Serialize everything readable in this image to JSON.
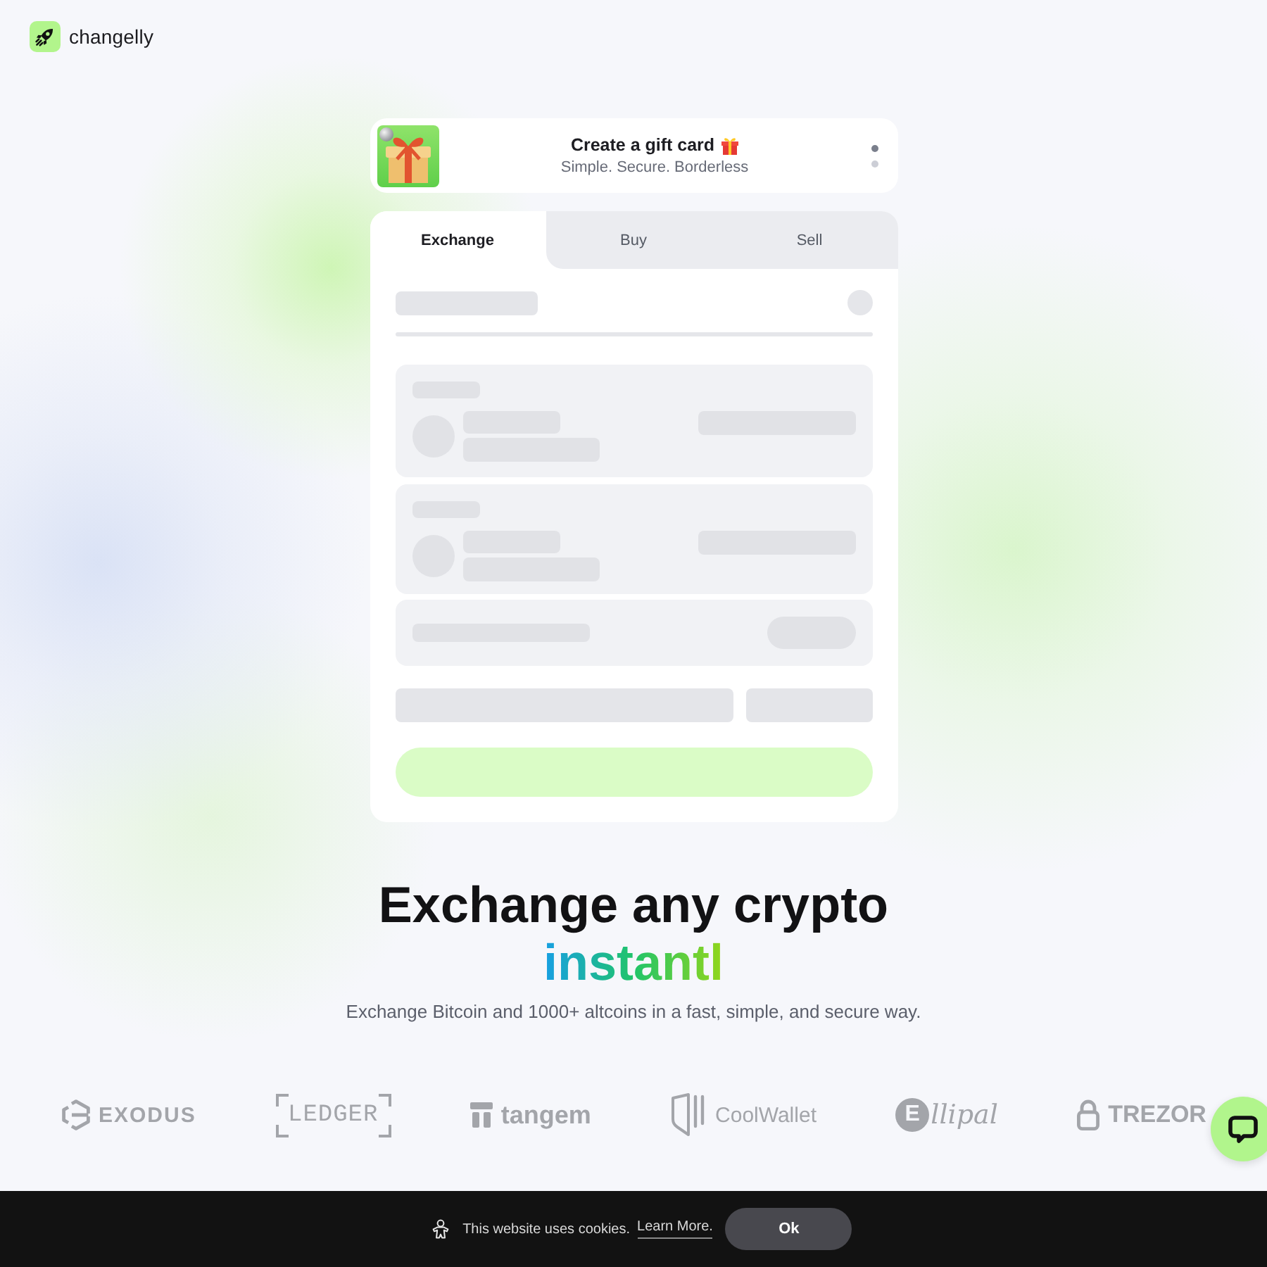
{
  "header": {
    "brand": "changelly"
  },
  "gift_banner": {
    "title": "Create a gift card",
    "subtitle": "Simple. Secure. Borderless",
    "dots": [
      {
        "selected": true
      },
      {
        "selected": false
      }
    ]
  },
  "tabs": [
    {
      "label": "Exchange",
      "selected": true
    },
    {
      "label": "Buy",
      "selected": false
    },
    {
      "label": "Sell",
      "selected": false
    }
  ],
  "hero": {
    "title": "Exchange any crypto",
    "highlight": "instantl",
    "subtitle": "Exchange Bitcoin and 1000+ altcoins in a fast, simple, and secure way."
  },
  "partners": [
    {
      "kind": "exodus",
      "name": "EXODUS"
    },
    {
      "kind": "ledger",
      "name": "LEDGER"
    },
    {
      "kind": "tangem",
      "name": "tangem"
    },
    {
      "kind": "coolwallet",
      "name": "CoolWallet"
    },
    {
      "kind": "ellipal",
      "mark": "E",
      "name": "llipal"
    },
    {
      "kind": "trezor",
      "name": "TREZOR"
    }
  ],
  "cookie_bar": {
    "text": "This website uses cookies.",
    "link": "Learn More.",
    "button": "Ok"
  }
}
